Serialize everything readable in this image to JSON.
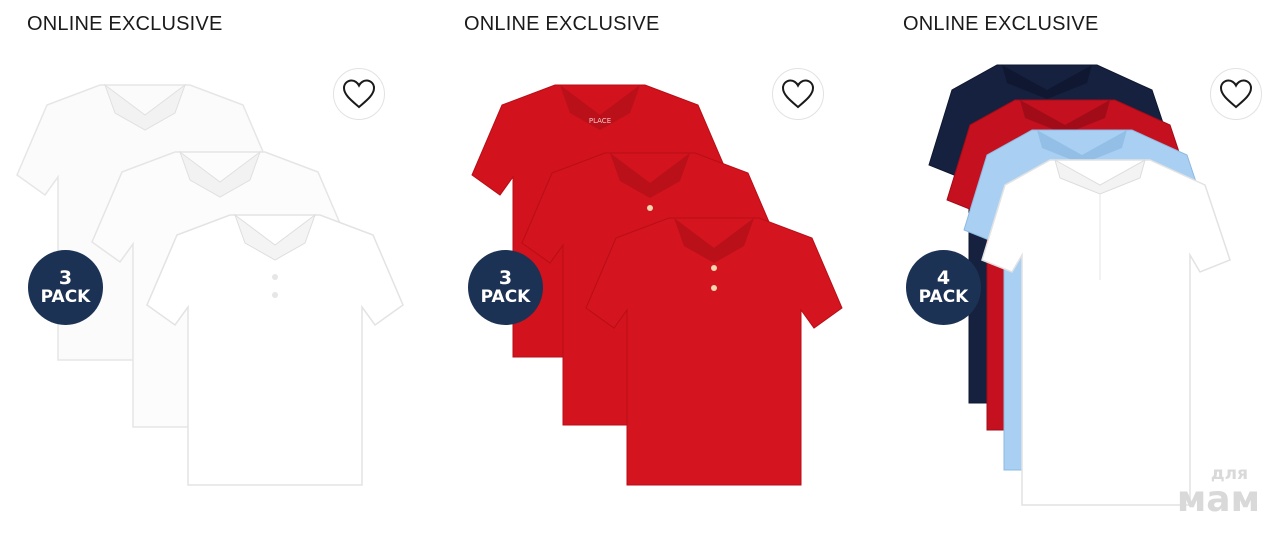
{
  "products": [
    {
      "label": "ONLINE EXCLUSIVE",
      "badge": {
        "number": "3",
        "text": "PACK"
      },
      "favorite_icon": "heart-outline-icon",
      "shirt_colors": [
        "#ffffff",
        "#ffffff",
        "#ffffff"
      ],
      "shirt_style": "boys-polo"
    },
    {
      "label": "ONLINE EXCLUSIVE",
      "badge": {
        "number": "3",
        "text": "PACK"
      },
      "favorite_icon": "heart-outline-icon",
      "shirt_colors": [
        "#d2121c",
        "#d2121c",
        "#d2121c"
      ],
      "shirt_style": "boys-polo",
      "brand_tag": "PLACE"
    },
    {
      "label": "ONLINE EXCLUSIVE",
      "badge": {
        "number": "4",
        "text": "PACK"
      },
      "favorite_icon": "heart-outline-icon",
      "shirt_colors": [
        "#15213f",
        "#c4101f",
        "#a9d0f3",
        "#ffffff"
      ],
      "shirt_style": "girls-polo"
    }
  ],
  "watermark": {
    "line1": "для",
    "line2": "мам"
  },
  "colors": {
    "badge": "#1b3255",
    "text": "#1a1a1a"
  }
}
